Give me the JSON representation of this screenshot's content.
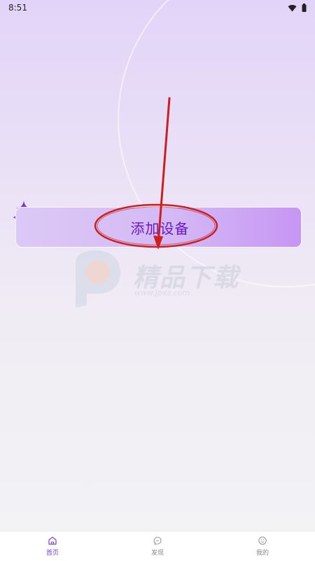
{
  "status_bar": {
    "time": "8:51"
  },
  "main": {
    "add_device_label": "添加设备"
  },
  "watermark": {
    "title": "精品下载",
    "url": "www.jpxz.com"
  },
  "bottom_nav": {
    "items": [
      {
        "label": "首页",
        "icon": "home-icon",
        "active": true
      },
      {
        "label": "发现",
        "icon": "discover-icon",
        "active": false
      },
      {
        "label": "我的",
        "icon": "profile-icon",
        "active": false
      }
    ]
  },
  "colors": {
    "accent": "#7b3fe4",
    "button_text": "#6a18c8",
    "annotation": "#cc1f1f"
  }
}
